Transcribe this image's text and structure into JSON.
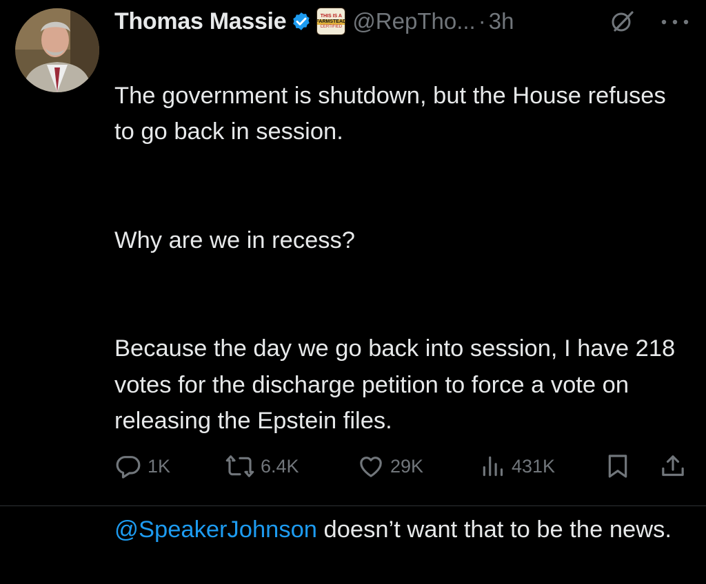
{
  "author": {
    "name": "Thomas Massie",
    "handle": "@RepTho...",
    "separator": "·",
    "time": "3h",
    "affiliation_badge": {
      "line1": "THIS IS A",
      "line2": "FARMSTEAD",
      "line3": "CERTIFIED"
    }
  },
  "tweet": {
    "paragraphs": [
      "The government is shutdown, but the House refuses to go back in session.",
      "Why are we in recess?",
      "Because the day we go back into session, I have 218 votes for the discharge petition to force a vote on releasing the Epstein files."
    ],
    "last_paragraph": {
      "mention": "@SpeakerJohnson",
      "text": " doesn’t want that to be the news."
    }
  },
  "actions": {
    "replies": "1K",
    "reposts": "6.4K",
    "likes": "29K",
    "views": "431K"
  },
  "icons": {
    "verified": "verified-badge-icon",
    "grok": "grok-icon",
    "more": "more-icon",
    "reply": "reply-icon",
    "repost": "repost-icon",
    "like": "heart-icon",
    "views": "views-icon",
    "bookmark": "bookmark-icon",
    "share": "share-icon"
  },
  "colors": {
    "background": "#000000",
    "text": "#e7e9ea",
    "secondary": "#71767b",
    "accent": "#1d9bf0"
  }
}
